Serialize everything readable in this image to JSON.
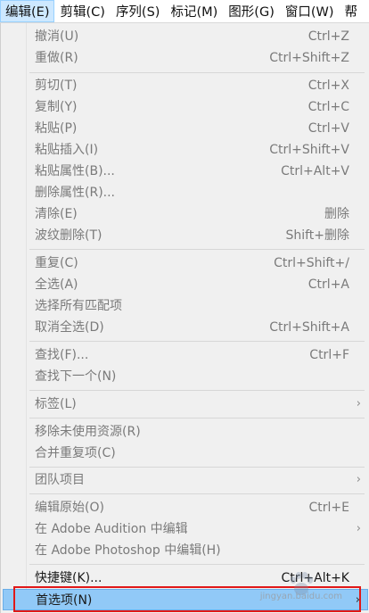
{
  "menubar": {
    "items": [
      {
        "label": "编辑(E)",
        "active": true
      },
      {
        "label": "剪辑(C)"
      },
      {
        "label": "序列(S)"
      },
      {
        "label": "标记(M)"
      },
      {
        "label": "图形(G)"
      },
      {
        "label": "窗口(W)"
      },
      {
        "label": "帮"
      }
    ]
  },
  "menu": {
    "items": [
      {
        "label": "撤消(U)",
        "shortcut": "Ctrl+Z",
        "disabled": true
      },
      {
        "label": "重做(R)",
        "shortcut": "Ctrl+Shift+Z",
        "disabled": true
      },
      {
        "label": "剪切(T)",
        "shortcut": "Ctrl+X",
        "disabled": true
      },
      {
        "label": "复制(Y)",
        "shortcut": "Ctrl+C",
        "disabled": true
      },
      {
        "label": "粘贴(P)",
        "shortcut": "Ctrl+V",
        "disabled": true
      },
      {
        "label": "粘贴插入(I)",
        "shortcut": "Ctrl+Shift+V",
        "disabled": true
      },
      {
        "label": "粘贴属性(B)...",
        "shortcut": "Ctrl+Alt+V",
        "disabled": true
      },
      {
        "label": "删除属性(R)...",
        "shortcut": "",
        "disabled": true
      },
      {
        "label": "清除(E)",
        "shortcut": "删除",
        "disabled": true
      },
      {
        "label": "波纹删除(T)",
        "shortcut": "Shift+删除",
        "disabled": true
      },
      {
        "label": "重复(C)",
        "shortcut": "Ctrl+Shift+/",
        "disabled": true
      },
      {
        "label": "全选(A)",
        "shortcut": "Ctrl+A",
        "disabled": true
      },
      {
        "label": "选择所有匹配项",
        "shortcut": "",
        "disabled": true
      },
      {
        "label": "取消全选(D)",
        "shortcut": "Ctrl+Shift+A",
        "disabled": true
      },
      {
        "label": "查找(F)...",
        "shortcut": "Ctrl+F",
        "disabled": true
      },
      {
        "label": "查找下一个(N)",
        "shortcut": "",
        "disabled": true
      },
      {
        "label": "标签(L)",
        "shortcut": "",
        "disabled": true,
        "submenu": true
      },
      {
        "label": "移除未使用资源(R)",
        "shortcut": "",
        "disabled": true
      },
      {
        "label": "合并重复项(C)",
        "shortcut": "",
        "disabled": true
      },
      {
        "label": "团队项目",
        "shortcut": "",
        "disabled": true,
        "submenu": true
      },
      {
        "label": "编辑原始(O)",
        "shortcut": "Ctrl+E",
        "disabled": true
      },
      {
        "label": "在 Adobe Audition 中编辑",
        "shortcut": "",
        "disabled": true,
        "submenu": true
      },
      {
        "label": "在 Adobe Photoshop 中编辑(H)",
        "shortcut": "",
        "disabled": true
      },
      {
        "label": "快捷键(K)...",
        "shortcut": "Ctrl+Alt+K",
        "disabled": false
      },
      {
        "label": "首选项(N)",
        "shortcut": "",
        "disabled": false,
        "submenu": true,
        "highlighted": true
      }
    ]
  },
  "submenu_arrow": "›",
  "watermark": "jingyan.baidu.com",
  "colors": {
    "highlight": "#91c9f7",
    "annotation": "#e01818",
    "active_menubar": "#cde8ff"
  }
}
